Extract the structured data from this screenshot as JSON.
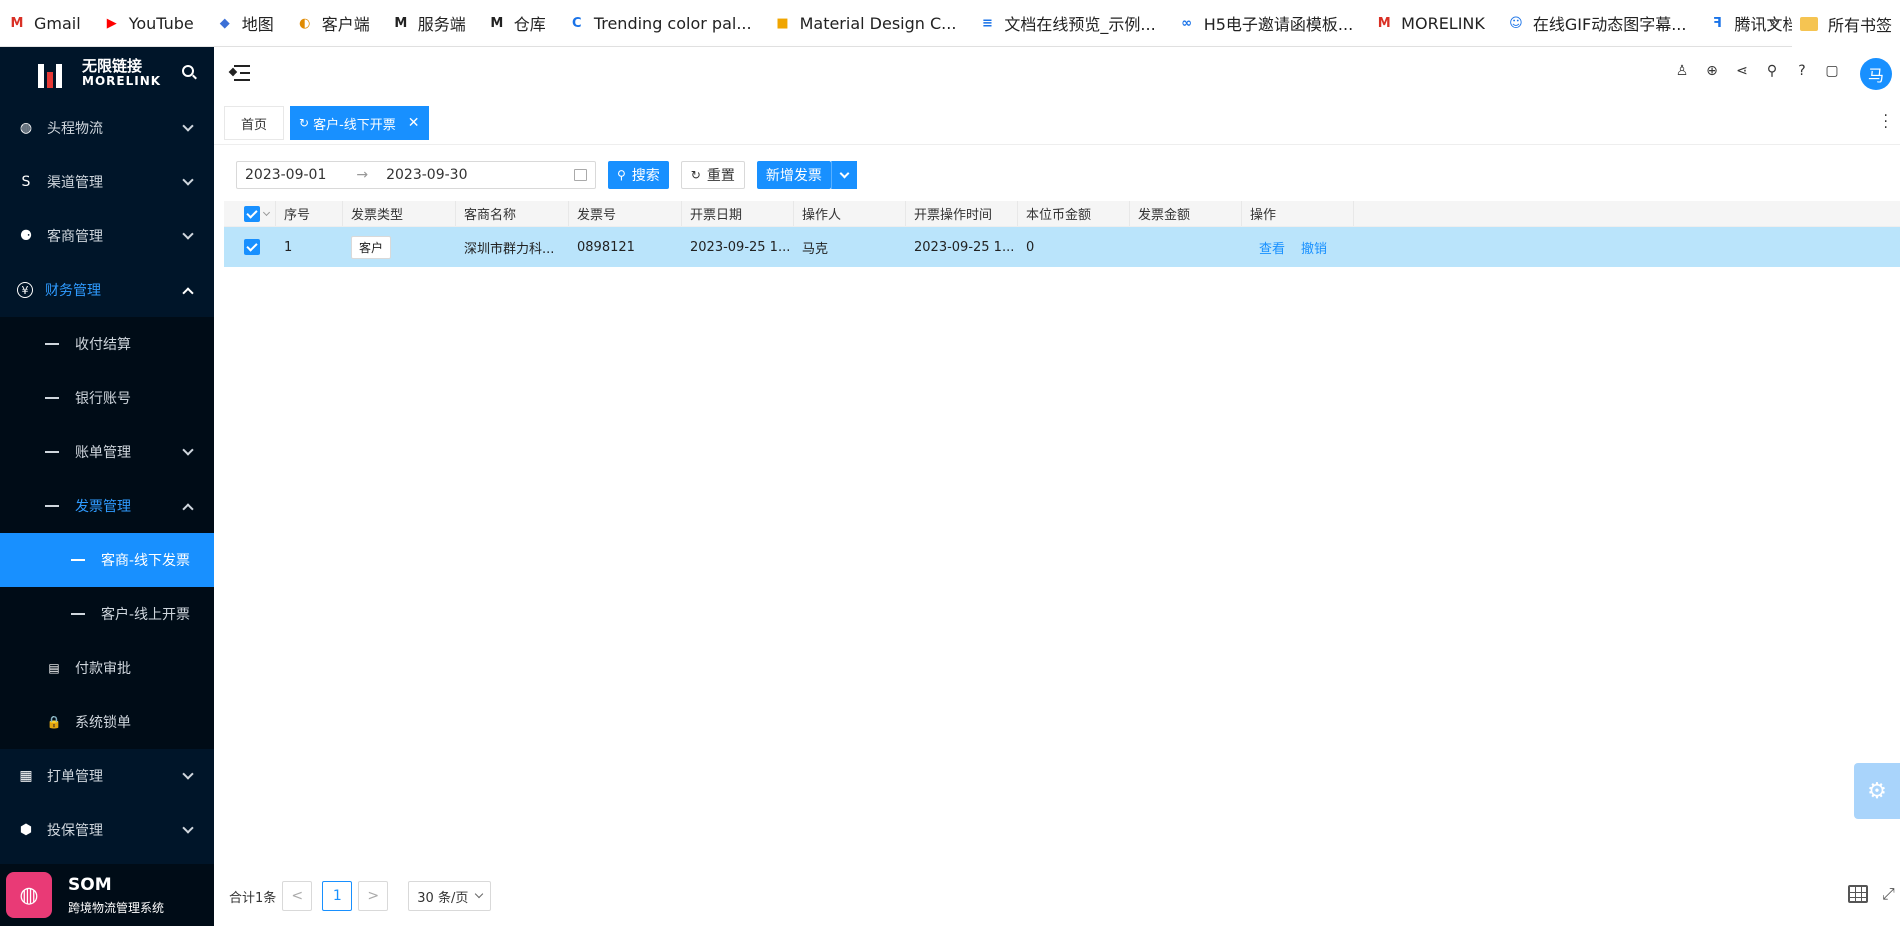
{
  "bookmarks": {
    "items": [
      {
        "label": "Gmail",
        "icon": "gmail-icon",
        "color": "#d93025",
        "glyph": "M"
      },
      {
        "label": "YouTube",
        "icon": "youtube-icon",
        "color": "#ff0000",
        "glyph": "▶"
      },
      {
        "label": "地图",
        "icon": "map-icon",
        "color": "#3b6fd6",
        "glyph": "◆"
      },
      {
        "label": "客户端",
        "icon": "client-icon",
        "color": "#e08a00",
        "glyph": "◐"
      },
      {
        "label": "服务端",
        "icon": "morelink-icon",
        "color": "#222222",
        "glyph": "M"
      },
      {
        "label": "仓库",
        "icon": "morelink-icon",
        "color": "#222222",
        "glyph": "M"
      },
      {
        "label": "Trending color pal...",
        "icon": "coolors-icon",
        "color": "#1a73e8",
        "glyph": "C"
      },
      {
        "label": "Material Design C...",
        "icon": "material-icon",
        "color": "#f0a500",
        "glyph": "■"
      },
      {
        "label": "文档在线预览_示例...",
        "icon": "doc-icon",
        "color": "#1a73e8",
        "glyph": "≡"
      },
      {
        "label": "H5电子邀请函模板...",
        "icon": "h5-icon",
        "color": "#1a73e8",
        "glyph": "∞"
      },
      {
        "label": "MORELINK",
        "icon": "morelink-red-icon",
        "color": "#d93025",
        "glyph": "M"
      },
      {
        "label": "在线GIF动态图字幕...",
        "icon": "gif-icon",
        "color": "#1a73e8",
        "glyph": "☺"
      },
      {
        "label": "腾讯文档",
        "icon": "tencent-doc-icon",
        "color": "#1a73e8",
        "glyph": "ꟻ"
      }
    ],
    "more": "»",
    "folder_label": "所有书签"
  },
  "sidebar": {
    "logo_title": "无限链接",
    "logo_sub": "MORELINK",
    "menu": [
      {
        "label": "头程物流",
        "icon": "globe-icon",
        "glyph": "◍"
      },
      {
        "label": "渠道管理",
        "icon": "route-icon",
        "glyph": "S"
      },
      {
        "label": "客商管理",
        "icon": "merchant-icon",
        "glyph": "⚈"
      }
    ],
    "finance": {
      "label": "财务管理",
      "icon": "yen-icon",
      "glyph": "¥",
      "children": [
        "收付结算",
        "银行账号",
        "账单管理"
      ],
      "invoice": {
        "label": "发票管理",
        "children": [
          "客商-线下发票",
          "客户-线上开票"
        ]
      },
      "after": [
        {
          "label": "付款审批",
          "icon": "clipboard-icon",
          "glyph": "▤"
        },
        {
          "label": "系统锁单",
          "icon": "lock-icon",
          "glyph": "🔒"
        }
      ]
    },
    "menu_bottom": [
      {
        "label": "打单管理",
        "icon": "calendar-icon",
        "glyph": "▦"
      },
      {
        "label": "投保管理",
        "icon": "shield-icon",
        "glyph": "⬢"
      }
    ],
    "system_name": "SOM",
    "system_desc": "跨境物流管理系统"
  },
  "header": {
    "icons": [
      "user-switch-icon",
      "globe-icon",
      "share-icon",
      "search-icon",
      "help-icon",
      "bag-icon"
    ],
    "avatar_text": "马"
  },
  "tabs": {
    "home": "首页",
    "current": "客户-线下开票"
  },
  "filter": {
    "start_date": "2023-09-01",
    "end_date": "2023-09-30",
    "range_sep": "→",
    "search_label": "搜索",
    "reset_label": "重置",
    "add_label": "新增发票"
  },
  "table": {
    "headers": [
      "序号",
      "发票类型",
      "客商名称",
      "发票号",
      "开票日期",
      "操作人",
      "开票操作时间",
      "本位币金额",
      "发票金额",
      "操作"
    ],
    "rows": [
      {
        "index": "1",
        "type": "客户",
        "name": "深圳市群力科...",
        "invoice_no": "0898121",
        "date": "2023-09-25 1...",
        "operator": "马克",
        "op_time": "2023-09-25 1...",
        "base_amount": "0",
        "amount": "",
        "view": "查看",
        "revoke": "撤销"
      }
    ]
  },
  "pagination": {
    "total": "合计1条",
    "prev": "<",
    "page": "1",
    "next": ">",
    "page_size": "30 条/页"
  },
  "colors": {
    "primary": "#1890ff",
    "sidebar_bg": "#001529",
    "selected_row": "#bae4fb"
  }
}
